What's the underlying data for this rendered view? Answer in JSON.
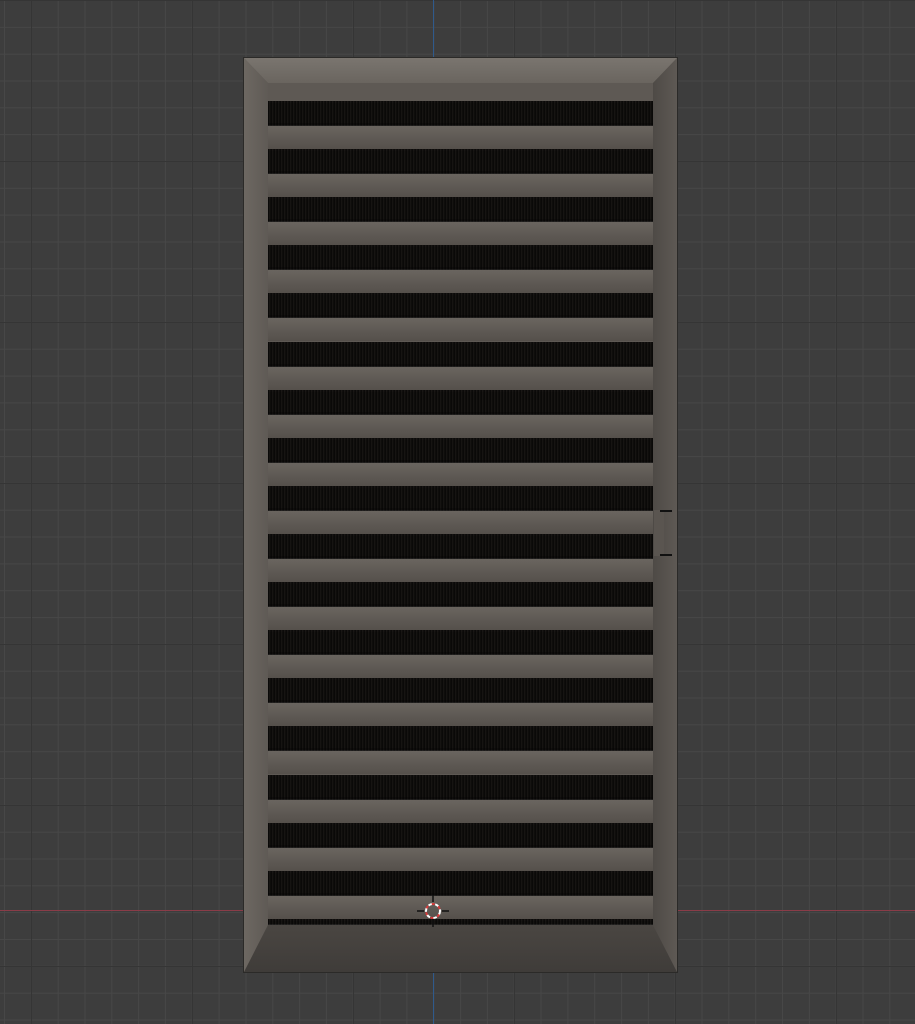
{
  "viewport": {
    "name": "3D viewport",
    "object": "door",
    "slat_count": 18,
    "colors": {
      "background": "#3d3d3d",
      "grid_minor": "#474747",
      "grid_major": "#353535",
      "x_axis": "#8a3c48",
      "y_axis": "#2f5a8c",
      "door_surface": "#5e5954"
    },
    "icons": [
      "3d-cursor-icon"
    ]
  }
}
